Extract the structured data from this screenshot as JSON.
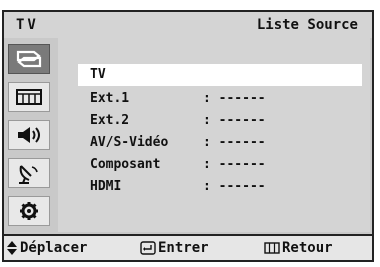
{
  "header": {
    "left_label": "TV",
    "title": "Liste Source"
  },
  "sidebar": {
    "items": [
      {
        "icon": "input-icon",
        "active": true
      },
      {
        "icon": "picture-icon",
        "active": false
      },
      {
        "icon": "sound-icon",
        "active": false
      },
      {
        "icon": "channel-icon",
        "active": false
      },
      {
        "icon": "setup-icon",
        "active": false
      }
    ]
  },
  "sources": [
    {
      "label": "TV",
      "value": "",
      "selected": true
    },
    {
      "label": "Ext.1",
      "value": ": ------",
      "selected": false
    },
    {
      "label": "Ext.2",
      "value": ": ------",
      "selected": false
    },
    {
      "label": "AV/S-Vidéo",
      "value": ": ------",
      "selected": false
    },
    {
      "label": "Composant",
      "value": ": ------",
      "selected": false
    },
    {
      "label": "HDMI",
      "value": ": ------",
      "selected": false
    }
  ],
  "footer": {
    "move_label": "Déplacer",
    "enter_label": "Entrer",
    "return_label": "Retour",
    "move_icon": "up-down-arrows-icon",
    "enter_icon": "enter-icon",
    "return_icon": "menu-icon"
  }
}
